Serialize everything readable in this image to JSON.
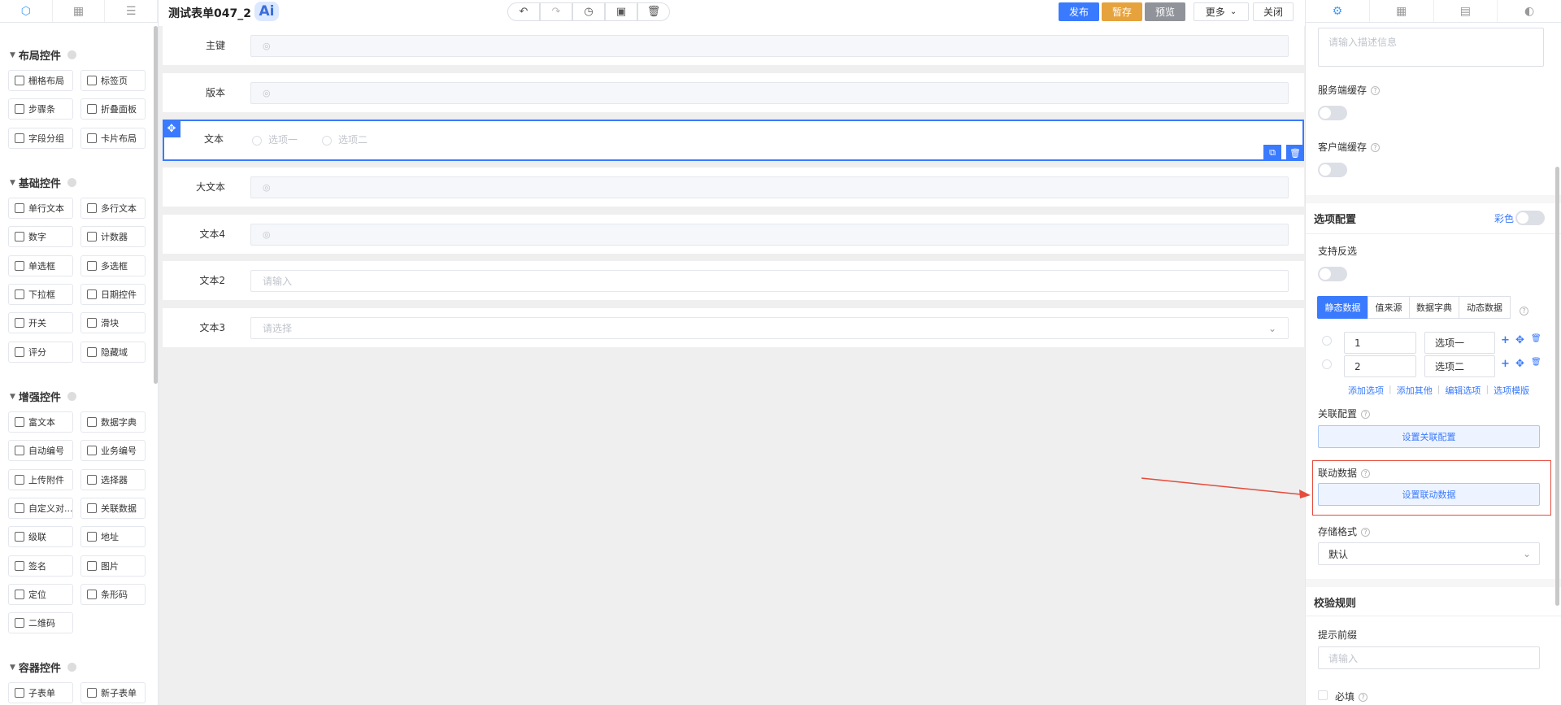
{
  "left": {
    "groups": [
      {
        "title": "布局控件",
        "items": [
          "栅格布局",
          "标签页",
          "步骤条",
          "折叠面板",
          "字段分组",
          "卡片布局"
        ]
      },
      {
        "title": "基础控件",
        "items": [
          "单行文本",
          "多行文本",
          "数字",
          "计数器",
          "单选框",
          "多选框",
          "下拉框",
          "日期控件",
          "开关",
          "滑块",
          "评分",
          "隐藏域"
        ]
      },
      {
        "title": "增强控件",
        "items": [
          "富文本",
          "数据字典",
          "自动编号",
          "业务编号",
          "上传附件",
          "选择器",
          "自定义对...",
          "关联数据",
          "级联",
          "地址",
          "签名",
          "图片",
          "定位",
          "条形码",
          "二维码"
        ]
      },
      {
        "title": "容器控件",
        "items": [
          "子表单",
          "新子表单"
        ]
      }
    ]
  },
  "header": {
    "title": "测试表单047_2",
    "ai_label": "Ai",
    "publish": "发布",
    "save": "暂存",
    "preview": "预览",
    "more": "更多",
    "close": "关闭"
  },
  "canvas": {
    "rows": [
      {
        "label": "主键",
        "value": "",
        "type": "hidden"
      },
      {
        "label": "版本",
        "value": "",
        "type": "hidden"
      },
      {
        "label": "文本",
        "type": "radio",
        "options": [
          "选项一",
          "选项二"
        ]
      },
      {
        "label": "大文本",
        "value": "",
        "type": "hidden"
      },
      {
        "label": "文本4",
        "value": "",
        "type": "hidden"
      },
      {
        "label": "文本2",
        "value": "请输入",
        "type": "input"
      },
      {
        "label": "文本3",
        "value": "请选择",
        "type": "select"
      }
    ]
  },
  "right": {
    "desc_placeholder": "请输入描述信息",
    "server_cache": "服务端缓存",
    "client_cache": "客户端缓存",
    "option_config": "选项配置",
    "colorful": "彩色",
    "support_unselect": "支持反选",
    "source_tabs": [
      "静态数据",
      "值来源",
      "数据字典",
      "动态数据"
    ],
    "options": [
      {
        "value": "1",
        "label": "选项一"
      },
      {
        "value": "2",
        "label": "选项二"
      }
    ],
    "links": [
      "添加选项",
      "添加其他",
      "编辑选项",
      "选项模版"
    ],
    "relation_config": "关联配置",
    "relation_button": "设置关联配置",
    "linkage_data": "联动数据",
    "linkage_button": "设置联动数据",
    "storage_format": "存储格式",
    "storage_value": "默认",
    "validation_rules": "校验规则",
    "prefix_label": "提示前缀",
    "prefix_placeholder": "请输入",
    "required": "必填"
  },
  "colors": {
    "primary": "#3a7afe",
    "save": "#e6a23c",
    "preview": "#909399",
    "highlight": "#e64b3c"
  }
}
